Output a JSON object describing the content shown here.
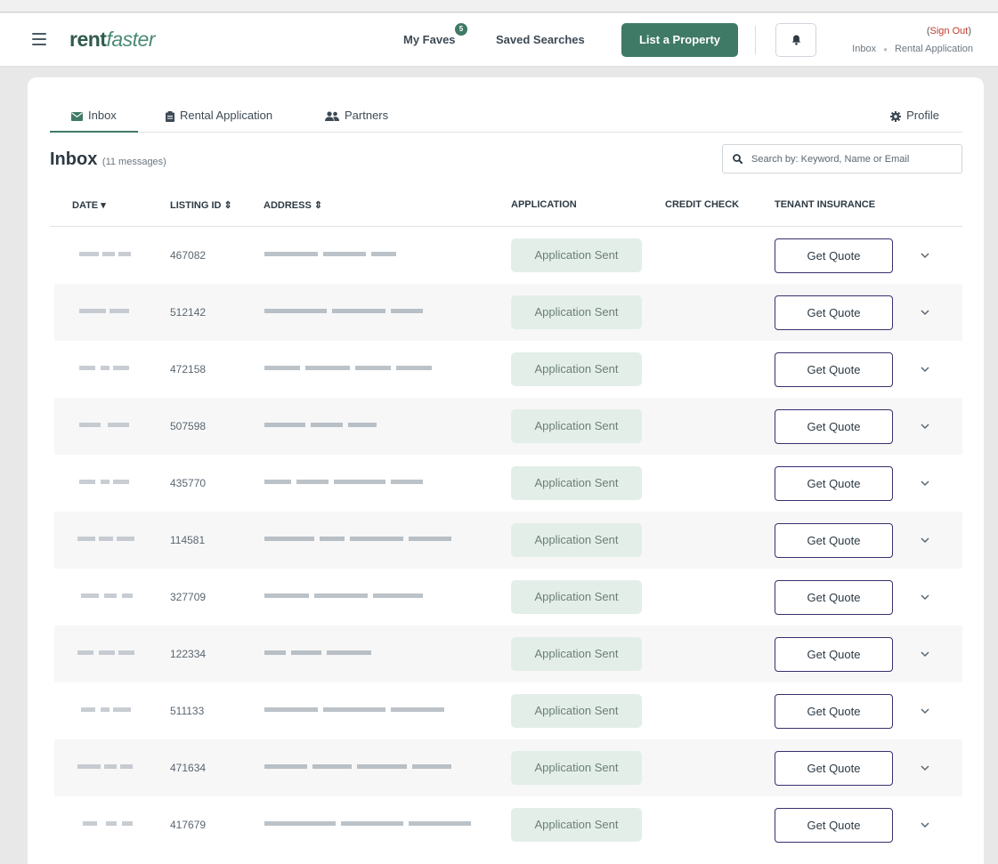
{
  "header": {
    "logo_part1": "rent",
    "logo_part2": "faster",
    "my_faves": "My Faves",
    "faves_count": "5",
    "saved_searches": "Saved Searches",
    "list_property": "List a Property",
    "sign_out_open": "(",
    "sign_out": "Sign Out",
    "sign_out_close": ")",
    "breadcrumb": [
      "Inbox",
      "Rental Application"
    ]
  },
  "tabs": [
    {
      "label": "Inbox",
      "icon": "envelope-icon",
      "active": true
    },
    {
      "label": "Rental Application",
      "icon": "clipboard-icon",
      "active": false
    },
    {
      "label": "Partners",
      "icon": "users-icon",
      "active": false
    }
  ],
  "profile_label": "Profile",
  "inbox": {
    "title": "Inbox",
    "count": "(11 messages)",
    "search_placeholder": "Search by: Keyword, Name or Email"
  },
  "columns": {
    "date": "DATE",
    "listing_id": "LISTING ID",
    "address": "ADDRESS",
    "application": "APPLICATION",
    "credit_check": "CREDIT CHECK",
    "tenant_insurance": "TENANT INSURANCE"
  },
  "rows": [
    {
      "listing_id": "467082",
      "application": "Application Sent",
      "insurance": "Get Quote"
    },
    {
      "listing_id": "512142",
      "application": "Application Sent",
      "insurance": "Get Quote"
    },
    {
      "listing_id": "472158",
      "application": "Application Sent",
      "insurance": "Get Quote"
    },
    {
      "listing_id": "507598",
      "application": "Application Sent",
      "insurance": "Get Quote"
    },
    {
      "listing_id": "435770",
      "application": "Application Sent",
      "insurance": "Get Quote"
    },
    {
      "listing_id": "114581",
      "application": "Application Sent",
      "insurance": "Get Quote"
    },
    {
      "listing_id": "327709",
      "application": "Application Sent",
      "insurance": "Get Quote"
    },
    {
      "listing_id": "122334",
      "application": "Application Sent",
      "insurance": "Get Quote"
    },
    {
      "listing_id": "511133",
      "application": "Application Sent",
      "insurance": "Get Quote"
    },
    {
      "listing_id": "471634",
      "application": "Application Sent",
      "insurance": "Get Quote"
    },
    {
      "listing_id": "417679",
      "application": "Application Sent",
      "insurance": "Get Quote"
    }
  ],
  "colors": {
    "brand": "#3f7a66",
    "application_bg": "#e4eee9",
    "quote_border": "#3a2f6e",
    "sign_out": "#c0392b"
  }
}
